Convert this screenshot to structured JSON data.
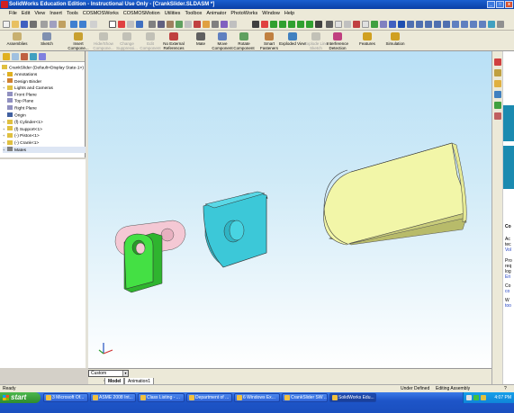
{
  "window": {
    "title": "SolidWorks Education Edition - Instructional Use Only - [CrankSlider.SLDASM *]",
    "controls": [
      "_",
      "□",
      "x"
    ]
  },
  "menu": [
    "File",
    "Edit",
    "View",
    "Insert",
    "Tools",
    "COSMOSWorks",
    "COSMOSMotion",
    "Utilities",
    "Toolbox",
    "Animator",
    "PhotoWorks",
    "Window",
    "Help"
  ],
  "command_manager": {
    "assemblies": "Assemblies",
    "sketch": "Sketch",
    "commands": [
      {
        "label": "Insert Compone...",
        "disabled": false,
        "color": "#c8a030"
      },
      {
        "label": "Hide/Show Compone...",
        "disabled": true,
        "color": "#909090"
      },
      {
        "label": "Change Suppressi...",
        "disabled": true,
        "color": "#909090"
      },
      {
        "label": "Edit Component",
        "disabled": true,
        "color": "#909090"
      },
      {
        "label": "No External References",
        "disabled": false,
        "color": "#c04040"
      },
      {
        "label": "Mate",
        "disabled": false,
        "color": "#606060"
      },
      {
        "label": "Move Component",
        "disabled": false,
        "color": "#6080c0"
      },
      {
        "label": "Rotate Component",
        "disabled": false,
        "color": "#60a060"
      },
      {
        "label": "Smart Fasteners",
        "disabled": false,
        "color": "#c08040"
      },
      {
        "label": "Exploded View",
        "disabled": false,
        "color": "#4080c0"
      },
      {
        "label": "Explode Line Sketch",
        "disabled": true,
        "color": "#909090"
      },
      {
        "label": "Interference Detection",
        "disabled": false,
        "color": "#c04080"
      },
      {
        "label": "Features",
        "disabled": false,
        "color": "#d0a020"
      },
      {
        "label": "Simulation",
        "disabled": false,
        "color": "#d0a020"
      }
    ]
  },
  "feature_tree": {
    "root": "CrankSlider  (Default<Display State-1>)",
    "items": [
      {
        "label": "Annotations",
        "expandable": true,
        "icon": "annotations-icon",
        "color": "#e0b020"
      },
      {
        "label": "Design Binder",
        "expandable": true,
        "icon": "design-binder-icon",
        "color": "#d08030"
      },
      {
        "label": "Lights and Cameras",
        "expandable": true,
        "icon": "lights-icon",
        "color": "#e0c040"
      },
      {
        "label": "Front Plane",
        "expandable": false,
        "icon": "plane-icon",
        "color": "#9090c0"
      },
      {
        "label": "Top Plane",
        "expandable": false,
        "icon": "plane-icon",
        "color": "#9090c0"
      },
      {
        "label": "Right Plane",
        "expandable": false,
        "icon": "plane-icon",
        "color": "#9090c0"
      },
      {
        "label": "Origin",
        "expandable": false,
        "icon": "origin-icon",
        "color": "#4060a0"
      },
      {
        "label": "(f) Cylinder<1>",
        "expandable": true,
        "icon": "part-icon",
        "color": "#e0c040"
      },
      {
        "label": "(f) Support<1>",
        "expandable": true,
        "icon": "part-icon",
        "color": "#e0c040"
      },
      {
        "label": "(-) Piston<1>",
        "expandable": true,
        "icon": "part-icon",
        "color": "#e0c040"
      },
      {
        "label": "(-) Crank<1>",
        "expandable": true,
        "icon": "part-icon",
        "color": "#e0c040"
      },
      {
        "label": "Mates",
        "expandable": true,
        "icon": "mates-icon",
        "color": "#808080"
      }
    ]
  },
  "viewport": {
    "config": "Custom",
    "tabs": [
      "Model",
      "Animation1"
    ],
    "parts": {
      "cylinder_color": "#f2f6a8",
      "piston_color": "#3cc8d8",
      "crank_color": "#44e044",
      "support_color": "#f4c8d4"
    }
  },
  "task_pane_text": [
    "Ac",
    "tec",
    "Vol",
    "Pro",
    "req",
    "log",
    "Eri",
    "Co",
    "co",
    "W",
    "too"
  ],
  "task_pane_headers": [
    "Co"
  ],
  "status": {
    "left": "Ready",
    "under_defined": "Under Defined",
    "editing": "Editing Assembly",
    "help": "?"
  },
  "taskbar": {
    "start": "start",
    "tasks": [
      "3 Microsoft Of...",
      "ASME 2008 Int...",
      "Class Listing - ...",
      "Department of ...",
      "6 Windows Ex...",
      "CrankSlider SW ...",
      "SolidWorks Edu..."
    ],
    "active_task_index": 6,
    "clock": "4:07 PM"
  }
}
